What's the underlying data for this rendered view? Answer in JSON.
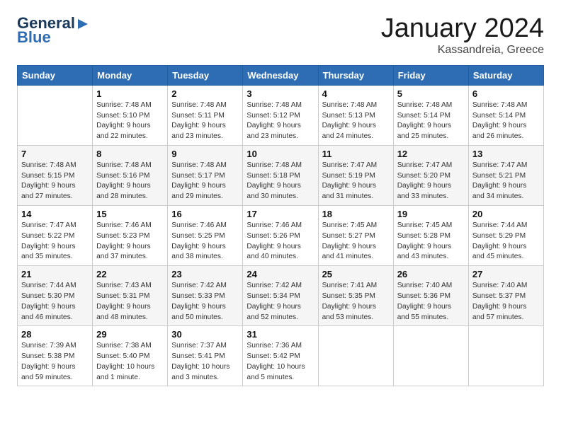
{
  "logo": {
    "general": "General",
    "blue": "Blue",
    "tagline": ""
  },
  "title": "January 2024",
  "subtitle": "Kassandreia, Greece",
  "columns": [
    "Sunday",
    "Monday",
    "Tuesday",
    "Wednesday",
    "Thursday",
    "Friday",
    "Saturday"
  ],
  "weeks": [
    [
      {
        "day": "",
        "info": ""
      },
      {
        "day": "1",
        "info": "Sunrise: 7:48 AM\nSunset: 5:10 PM\nDaylight: 9 hours\nand 22 minutes."
      },
      {
        "day": "2",
        "info": "Sunrise: 7:48 AM\nSunset: 5:11 PM\nDaylight: 9 hours\nand 23 minutes."
      },
      {
        "day": "3",
        "info": "Sunrise: 7:48 AM\nSunset: 5:12 PM\nDaylight: 9 hours\nand 23 minutes."
      },
      {
        "day": "4",
        "info": "Sunrise: 7:48 AM\nSunset: 5:13 PM\nDaylight: 9 hours\nand 24 minutes."
      },
      {
        "day": "5",
        "info": "Sunrise: 7:48 AM\nSunset: 5:14 PM\nDaylight: 9 hours\nand 25 minutes."
      },
      {
        "day": "6",
        "info": "Sunrise: 7:48 AM\nSunset: 5:14 PM\nDaylight: 9 hours\nand 26 minutes."
      }
    ],
    [
      {
        "day": "7",
        "info": "Sunrise: 7:48 AM\nSunset: 5:15 PM\nDaylight: 9 hours\nand 27 minutes."
      },
      {
        "day": "8",
        "info": "Sunrise: 7:48 AM\nSunset: 5:16 PM\nDaylight: 9 hours\nand 28 minutes."
      },
      {
        "day": "9",
        "info": "Sunrise: 7:48 AM\nSunset: 5:17 PM\nDaylight: 9 hours\nand 29 minutes."
      },
      {
        "day": "10",
        "info": "Sunrise: 7:48 AM\nSunset: 5:18 PM\nDaylight: 9 hours\nand 30 minutes."
      },
      {
        "day": "11",
        "info": "Sunrise: 7:47 AM\nSunset: 5:19 PM\nDaylight: 9 hours\nand 31 minutes."
      },
      {
        "day": "12",
        "info": "Sunrise: 7:47 AM\nSunset: 5:20 PM\nDaylight: 9 hours\nand 33 minutes."
      },
      {
        "day": "13",
        "info": "Sunrise: 7:47 AM\nSunset: 5:21 PM\nDaylight: 9 hours\nand 34 minutes."
      }
    ],
    [
      {
        "day": "14",
        "info": "Sunrise: 7:47 AM\nSunset: 5:22 PM\nDaylight: 9 hours\nand 35 minutes."
      },
      {
        "day": "15",
        "info": "Sunrise: 7:46 AM\nSunset: 5:23 PM\nDaylight: 9 hours\nand 37 minutes."
      },
      {
        "day": "16",
        "info": "Sunrise: 7:46 AM\nSunset: 5:25 PM\nDaylight: 9 hours\nand 38 minutes."
      },
      {
        "day": "17",
        "info": "Sunrise: 7:46 AM\nSunset: 5:26 PM\nDaylight: 9 hours\nand 40 minutes."
      },
      {
        "day": "18",
        "info": "Sunrise: 7:45 AM\nSunset: 5:27 PM\nDaylight: 9 hours\nand 41 minutes."
      },
      {
        "day": "19",
        "info": "Sunrise: 7:45 AM\nSunset: 5:28 PM\nDaylight: 9 hours\nand 43 minutes."
      },
      {
        "day": "20",
        "info": "Sunrise: 7:44 AM\nSunset: 5:29 PM\nDaylight: 9 hours\nand 45 minutes."
      }
    ],
    [
      {
        "day": "21",
        "info": "Sunrise: 7:44 AM\nSunset: 5:30 PM\nDaylight: 9 hours\nand 46 minutes."
      },
      {
        "day": "22",
        "info": "Sunrise: 7:43 AM\nSunset: 5:31 PM\nDaylight: 9 hours\nand 48 minutes."
      },
      {
        "day": "23",
        "info": "Sunrise: 7:42 AM\nSunset: 5:33 PM\nDaylight: 9 hours\nand 50 minutes."
      },
      {
        "day": "24",
        "info": "Sunrise: 7:42 AM\nSunset: 5:34 PM\nDaylight: 9 hours\nand 52 minutes."
      },
      {
        "day": "25",
        "info": "Sunrise: 7:41 AM\nSunset: 5:35 PM\nDaylight: 9 hours\nand 53 minutes."
      },
      {
        "day": "26",
        "info": "Sunrise: 7:40 AM\nSunset: 5:36 PM\nDaylight: 9 hours\nand 55 minutes."
      },
      {
        "day": "27",
        "info": "Sunrise: 7:40 AM\nSunset: 5:37 PM\nDaylight: 9 hours\nand 57 minutes."
      }
    ],
    [
      {
        "day": "28",
        "info": "Sunrise: 7:39 AM\nSunset: 5:38 PM\nDaylight: 9 hours\nand 59 minutes."
      },
      {
        "day": "29",
        "info": "Sunrise: 7:38 AM\nSunset: 5:40 PM\nDaylight: 10 hours\nand 1 minute."
      },
      {
        "day": "30",
        "info": "Sunrise: 7:37 AM\nSunset: 5:41 PM\nDaylight: 10 hours\nand 3 minutes."
      },
      {
        "day": "31",
        "info": "Sunrise: 7:36 AM\nSunset: 5:42 PM\nDaylight: 10 hours\nand 5 minutes."
      },
      {
        "day": "",
        "info": ""
      },
      {
        "day": "",
        "info": ""
      },
      {
        "day": "",
        "info": ""
      }
    ]
  ]
}
